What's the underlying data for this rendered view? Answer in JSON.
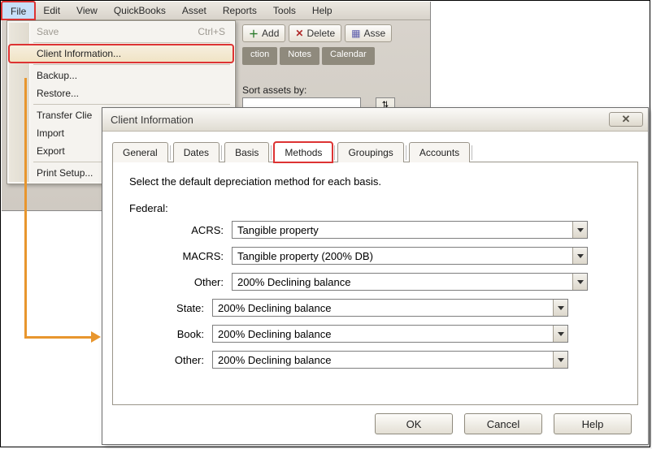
{
  "menubar": [
    "File",
    "Edit",
    "View",
    "QuickBooks",
    "Asset",
    "Reports",
    "Tools",
    "Help"
  ],
  "file_menu": {
    "save": "Save",
    "save_shortcut": "Ctrl+S",
    "client_info": "Client Information...",
    "backup": "Backup...",
    "restore": "Restore...",
    "transfer": "Transfer Clie",
    "import": "Import",
    "export": "Export",
    "print_setup": "Print Setup..."
  },
  "toolbar": {
    "add": "Add",
    "delete": "Delete",
    "asset": "Asse"
  },
  "subtabs": [
    "ction",
    "Notes",
    "Calendar"
  ],
  "sort_label": "Sort assets by:",
  "dialog": {
    "title": "Client Information",
    "tabs": [
      "General",
      "Dates",
      "Basis",
      "Methods",
      "Groupings",
      "Accounts"
    ],
    "instruction": "Select the default depreciation method for each basis.",
    "section_federal": "Federal:",
    "rows": {
      "acrs_label": "ACRS:",
      "acrs_value": "Tangible property",
      "macrs_label": "MACRS:",
      "macrs_value": "Tangible property (200% DB)",
      "other1_label": "Other:",
      "other1_value": "200% Declining balance",
      "state_label": "State:",
      "state_value": "200% Declining balance",
      "book_label": "Book:",
      "book_value": "200% Declining balance",
      "other2_label": "Other:",
      "other2_value": "200% Declining balance"
    },
    "buttons": {
      "ok": "OK",
      "cancel": "Cancel",
      "help": "Help"
    }
  }
}
